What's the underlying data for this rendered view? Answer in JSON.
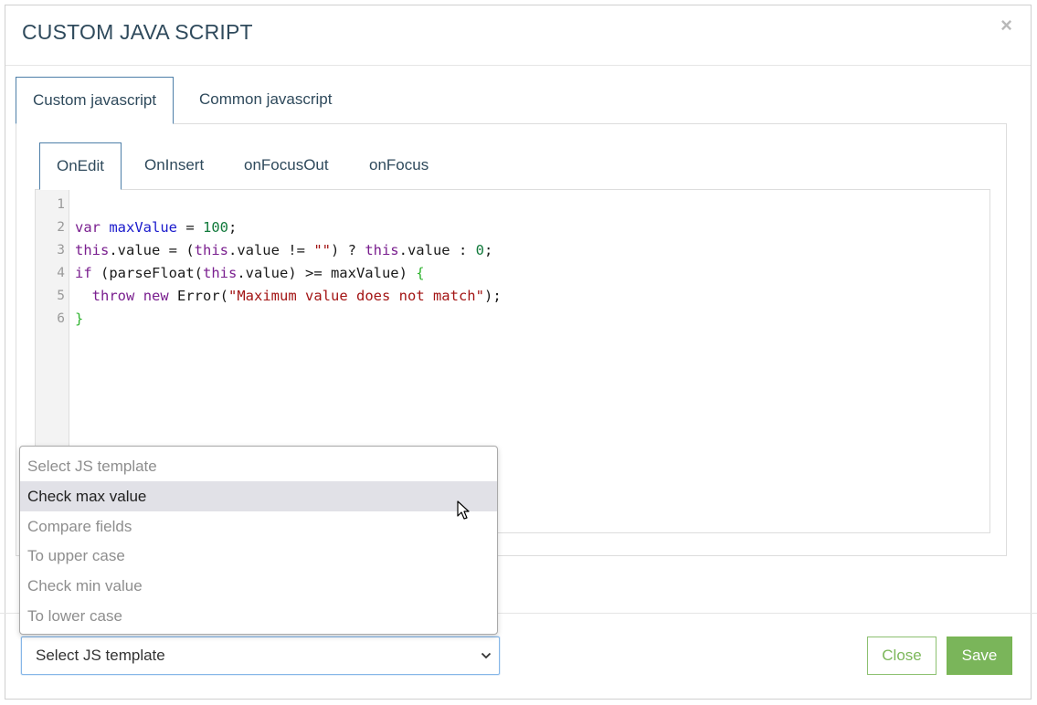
{
  "modal": {
    "title": "CUSTOM JAVA SCRIPT",
    "close_glyph": "×"
  },
  "outer_tabs": [
    {
      "label": "Custom javascript",
      "active": true
    },
    {
      "label": "Common javascript",
      "active": false
    }
  ],
  "inner_tabs": [
    {
      "label": "OnEdit",
      "active": true
    },
    {
      "label": "OnInsert",
      "active": false
    },
    {
      "label": "onFocusOut",
      "active": false
    },
    {
      "label": "onFocus",
      "active": false
    }
  ],
  "editor": {
    "line_numbers": [
      "1",
      "2",
      "3",
      "4",
      "5",
      "6"
    ],
    "lines": [
      "",
      "var maxValue = 100;",
      "this.value = (this.value != \"\") ? this.value : 0;",
      "if (parseFloat(this.value) >= maxValue) {",
      "  throw new Error(\"Maximum value does not match\");",
      "}"
    ]
  },
  "template_dropdown": {
    "options": [
      "Select JS template",
      "Check max value",
      "Compare fields",
      "To upper case",
      "Check min value",
      "To lower case"
    ],
    "hovered_option": "Check max value",
    "selected_value": "Select JS template"
  },
  "footer": {
    "close_label": "Close",
    "save_label": "Save"
  },
  "icons": {
    "close": "close-icon",
    "select_arrow": "chevron-down-icon",
    "cursor": "mouse-pointer-icon"
  },
  "colors": {
    "title": "#2f4a5c",
    "tab_active_border": "#4e7fa8",
    "save_button": "#7ab55a",
    "close_button_border": "#8cc070",
    "keyword": "#7a1f8f",
    "variable_def": "#1a1acc",
    "number": "#127a3c",
    "string": "#a31515",
    "bracket": "#2fb32f"
  }
}
